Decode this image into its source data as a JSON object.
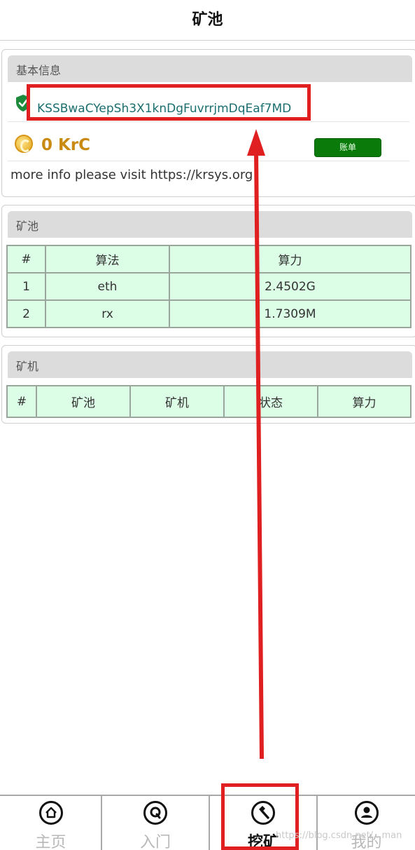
{
  "header": {
    "title": "矿池"
  },
  "basic_info": {
    "heading": "基本信息",
    "address": "KSSBwaCYepSh3X1knDgFuvrrjmDqEaf7MD",
    "balance": "0 KrC",
    "bill_button": "账单",
    "info_text": "more info please visit https://krsys.org"
  },
  "pool": {
    "heading": "矿池",
    "columns": [
      "#",
      "算法",
      "算力"
    ],
    "rows": [
      [
        "1",
        "eth",
        "2.4502G"
      ],
      [
        "2",
        "rx",
        "1.7309M"
      ]
    ]
  },
  "miners": {
    "heading": "矿机",
    "columns": [
      "#",
      "矿池",
      "矿机",
      "状态",
      "算力"
    ]
  },
  "tabbar": {
    "items": [
      {
        "label": "主页",
        "icon": "home-icon",
        "active": false
      },
      {
        "label": "入门",
        "icon": "q-icon",
        "active": false
      },
      {
        "label": "挖矿",
        "icon": "hammer-icon",
        "active": true
      },
      {
        "label": "我的",
        "icon": "user-icon",
        "active": false
      }
    ]
  },
  "watermark": "https://blog.csdn.net/...man",
  "colors": {
    "annotation_red": "#e02020",
    "accent_green": "#0a7a0a",
    "table_bg": "#dcfde6",
    "balance_gold": "#c98a12",
    "address_teal": "#1b6e6e"
  }
}
